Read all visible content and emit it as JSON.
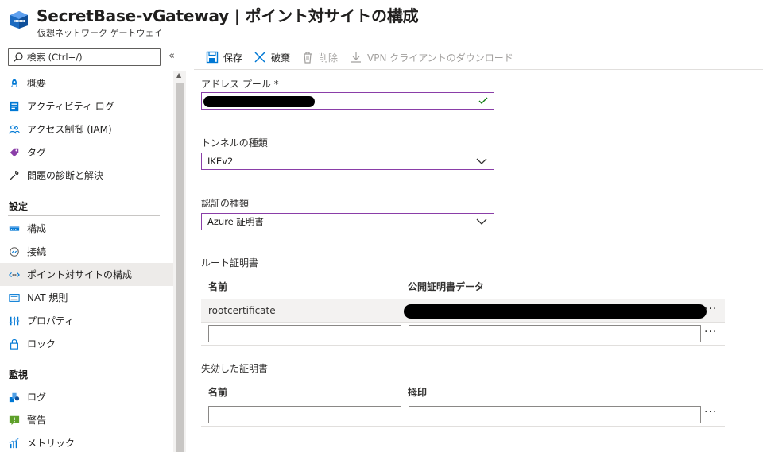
{
  "header": {
    "title": "SecretBase-vGateway | ポイント対サイトの構成",
    "subtitle": "仮想ネットワーク ゲートウェイ",
    "more_label": "···"
  },
  "sidebar": {
    "search_placeholder": "検索 (Ctrl+/)",
    "collapse_label": "«",
    "items_top": [
      {
        "label": "概要",
        "icon": "rocket-icon"
      },
      {
        "label": "アクティビティ ログ",
        "icon": "activity-log-icon"
      },
      {
        "label": "アクセス制御 (IAM)",
        "icon": "people-icon"
      },
      {
        "label": "タグ",
        "icon": "tag-icon"
      },
      {
        "label": "問題の診断と解決",
        "icon": "wrench-icon"
      }
    ],
    "section_settings": "設定",
    "items_settings": [
      {
        "label": "構成",
        "icon": "config-icon"
      },
      {
        "label": "接続",
        "icon": "connection-icon"
      },
      {
        "label": "ポイント対サイトの構成",
        "icon": "p2s-icon",
        "active": true
      },
      {
        "label": "NAT 規則",
        "icon": "nat-icon"
      },
      {
        "label": "プロパティ",
        "icon": "properties-icon"
      },
      {
        "label": "ロック",
        "icon": "lock-icon"
      }
    ],
    "section_monitor": "監視",
    "items_monitor": [
      {
        "label": "ログ",
        "icon": "logs-icon"
      },
      {
        "label": "警告",
        "icon": "alert-icon"
      },
      {
        "label": "メトリック",
        "icon": "metrics-icon"
      }
    ]
  },
  "toolbar": {
    "save_label": "保存",
    "discard_label": "破棄",
    "delete_label": "削除",
    "download_label": "VPN クライアントのダウンロード"
  },
  "form": {
    "address_pool_label": "アドレス プール *",
    "tunnel_type_label": "トンネルの種類",
    "tunnel_type_value": "IKEv2",
    "auth_type_label": "認証の種類",
    "auth_type_value": "Azure 証明書",
    "root_cert_section": "ルート証明書",
    "root_cert_col_name": "名前",
    "root_cert_col_data": "公開証明書データ",
    "root_cert_rows": [
      {
        "name": "rootcertificate"
      }
    ],
    "revoked_cert_section": "失効した証明書",
    "revoked_col_name": "名前",
    "revoked_col_thumbprint": "拇印",
    "row_menu_label": "···"
  },
  "colors": {
    "accent": "#0078d4",
    "focus_border": "#8a3ea8",
    "success": "#107c10"
  }
}
